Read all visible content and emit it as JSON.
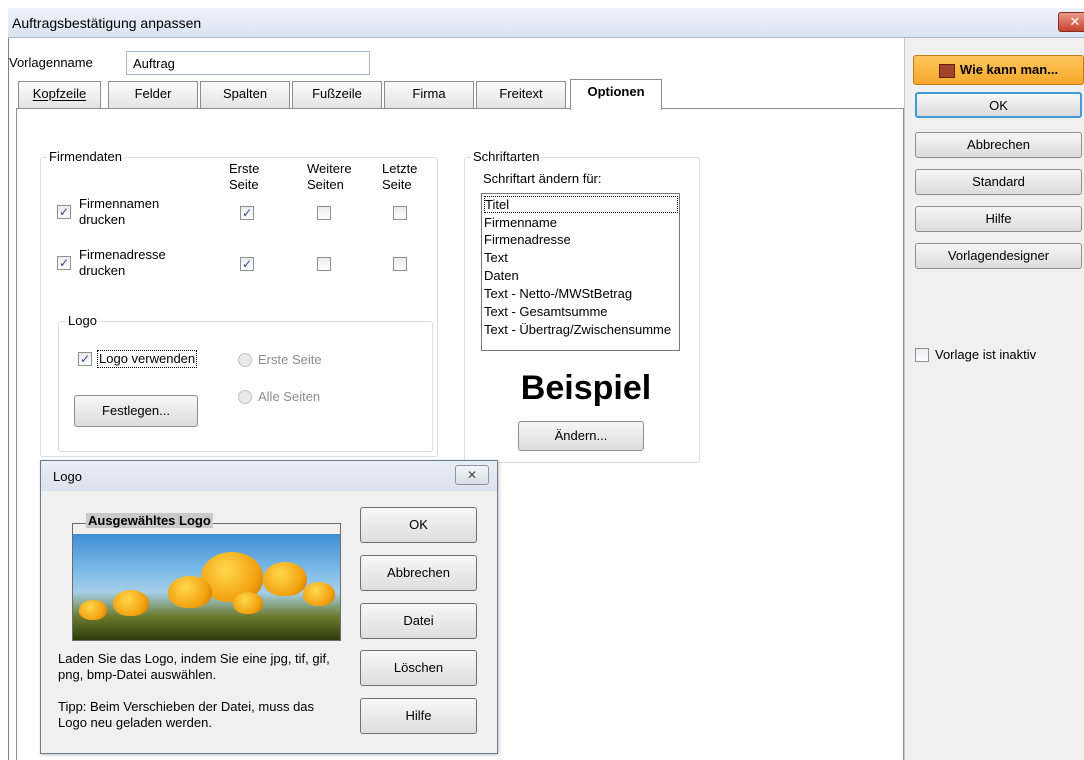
{
  "window": {
    "title": "Auftragsbestätigung anpassen",
    "close_glyph": "✕"
  },
  "template": {
    "label": "Vorlagenname",
    "value": "Auftrag"
  },
  "tabs": [
    {
      "label": "Kopfzeile"
    },
    {
      "label": "Felder"
    },
    {
      "label": "Spalten"
    },
    {
      "label": "Fußzeile"
    },
    {
      "label": "Firma"
    },
    {
      "label": "Freitext"
    },
    {
      "label": "Optionen",
      "active": true
    }
  ],
  "sidebar": {
    "help_label": "Wie kann man...",
    "buttons": [
      "OK",
      "Abbrechen",
      "Standard",
      "Hilfe",
      "Vorlagendesigner"
    ],
    "inactive_label": "Vorlage ist inaktiv"
  },
  "firmendaten": {
    "legend": "Firmendaten",
    "col_first": "Erste\nSeite",
    "col_more": "Weitere\nSeiten",
    "col_last": "Letzte\nSeite",
    "row1_label": "Firmennamen\ndrucken",
    "row2_label": "Firmenadresse\ndrucken"
  },
  "logo": {
    "legend": "Logo",
    "use_label": "Logo verwenden",
    "radio_first": "Erste Seite",
    "radio_all": "Alle Seiten",
    "set_button": "Festlegen..."
  },
  "schriftarten": {
    "legend": "Schriftarten",
    "subtitle": "Schriftart ändern für:",
    "items": [
      "Titel",
      "Firmenname",
      "Firmenadresse",
      "Text",
      "Daten",
      "Text - Netto-/MWStBetrag",
      "Text - Gesamtsumme",
      "Text - Übertrag/Zwischensumme"
    ],
    "example": "Beispiel",
    "change_button": "Ändern..."
  },
  "logo_dialog": {
    "title": "Logo",
    "close_glyph": "✕",
    "frame_label": "Ausgewähltes Logo",
    "buttons": [
      "OK",
      "Abbrechen",
      "Datei",
      "Löschen",
      "Hilfe"
    ],
    "info": "Laden Sie das Logo, indem Sie eine jpg, tif, gif, png, bmp-Datei auswählen.",
    "tip": "Tipp: Beim Verschieben der Datei, muss das Logo neu geladen werden."
  },
  "colors": {
    "help_button": "#f5a82a",
    "accent_border": "#3f9bd8"
  }
}
